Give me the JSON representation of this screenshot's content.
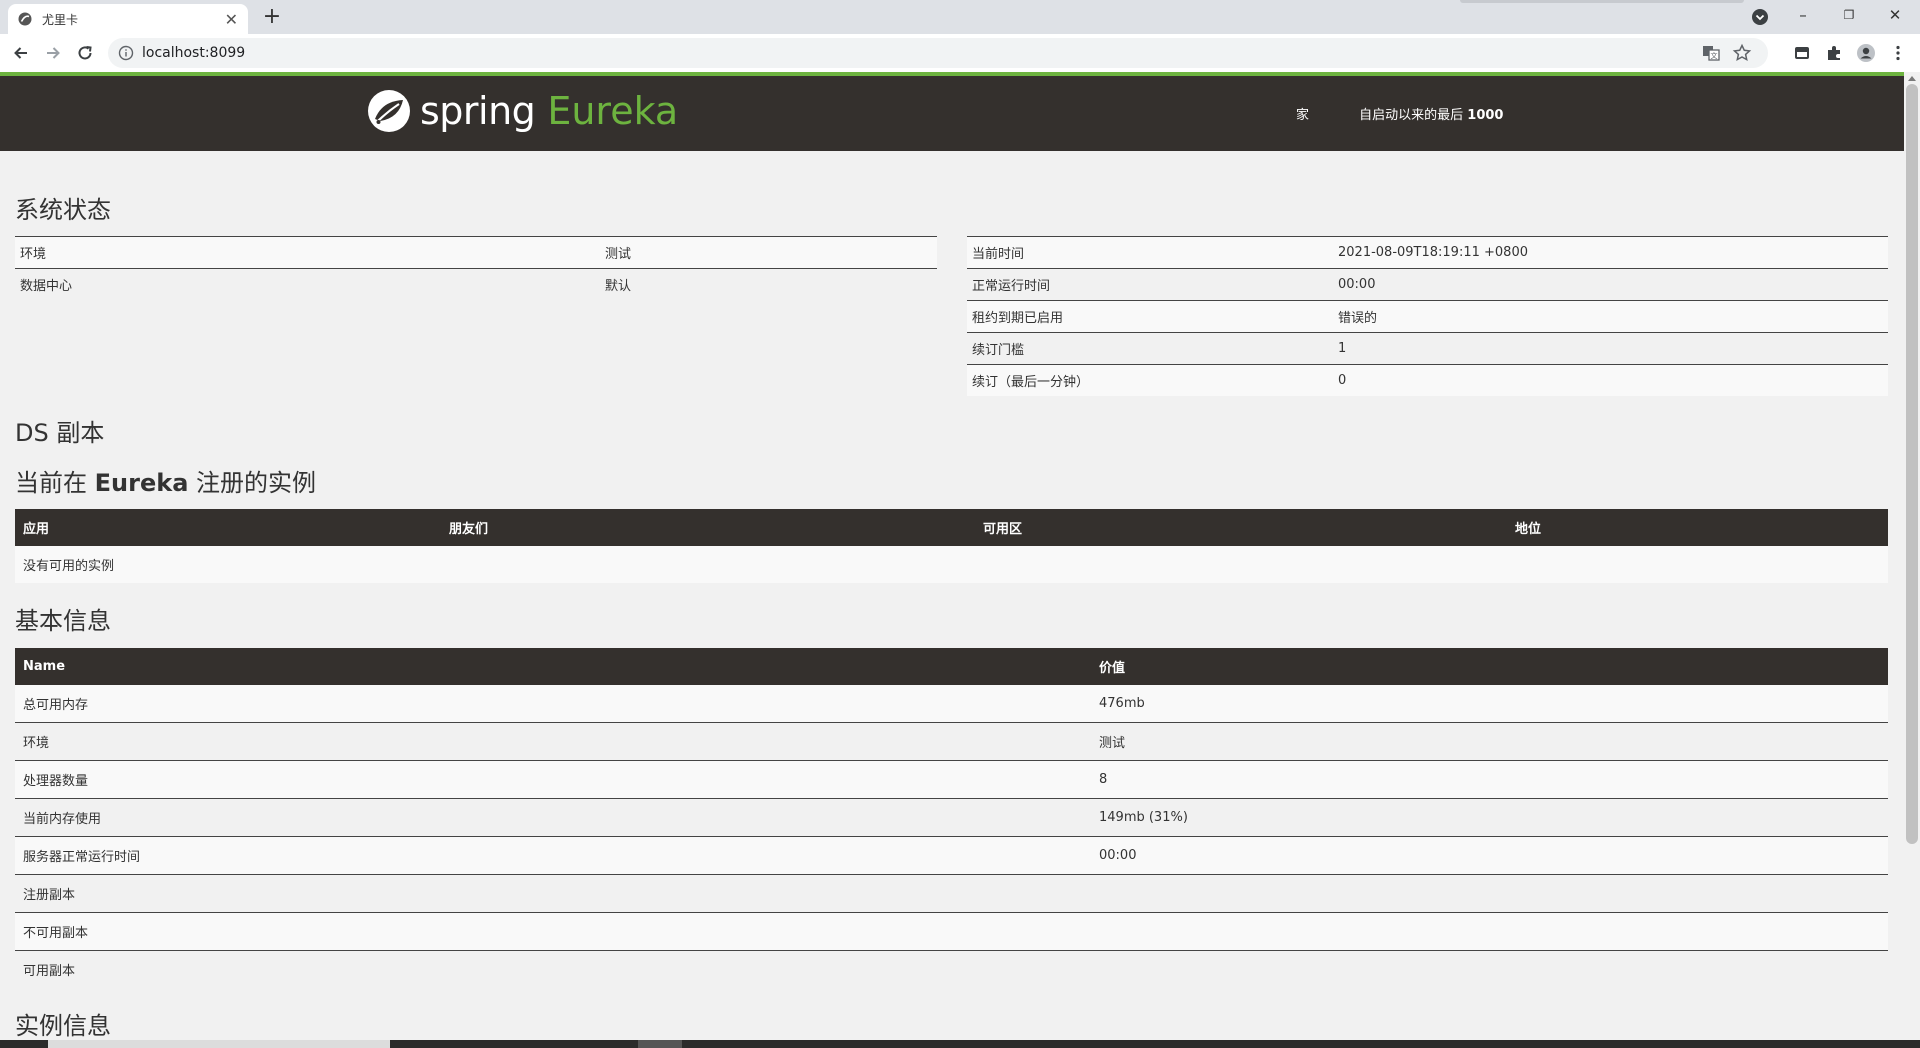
{
  "browser": {
    "tab_title": "尤里卡",
    "url": "localhost:8099",
    "minimize_label": "–",
    "maximize_label": "❐",
    "close_label": "✕",
    "new_tab_label": "+",
    "tab_close_label": "✕"
  },
  "header": {
    "logo_spring": "spring",
    "logo_eureka": "Eureka",
    "nav_home": "家",
    "nav_last_prefix": "自启动以来的最后 ",
    "nav_last_count": "1000"
  },
  "system_status": {
    "title": "系统状态",
    "left_rows": [
      {
        "label": "环境",
        "value": "测试"
      },
      {
        "label": "数据中心",
        "value": "默认"
      }
    ],
    "right_rows": [
      {
        "label": "当前时间",
        "value": "2021-08-09T18:19:11 +0800"
      },
      {
        "label": "正常运行时间",
        "value": "00:00"
      },
      {
        "label": "租约到期已启用",
        "value": "错误的"
      },
      {
        "label": "续订门槛",
        "value": "1"
      },
      {
        "label": "续订（最后一分钟）",
        "value": "0"
      }
    ]
  },
  "ds_replicas": {
    "title": "DS 副本"
  },
  "registered": {
    "title_prefix": "当前在 ",
    "title_bold": "Eureka",
    "title_suffix": " 注册的实例",
    "columns": [
      "应用",
      "朋友们",
      "可用区",
      "地位"
    ],
    "empty_text": "没有可用的实例"
  },
  "general_info": {
    "title": "基本信息",
    "columns": [
      "Name",
      "价值"
    ],
    "rows": [
      {
        "name": "总可用内存",
        "value": "476mb"
      },
      {
        "name": "环境",
        "value": "测试"
      },
      {
        "name": "处理器数量",
        "value": "8"
      },
      {
        "name": "当前内存使用",
        "value": "149mb (31%)"
      },
      {
        "name": "服务器正常运行时间",
        "value": "00:00"
      },
      {
        "name": "注册副本",
        "value": ""
      },
      {
        "name": "不可用副本",
        "value": ""
      },
      {
        "name": "可用副本",
        "value": ""
      }
    ]
  },
  "instance_info": {
    "title": "实例信息"
  },
  "colors": {
    "spring_green": "#6db33f",
    "header_dark": "#34302d"
  }
}
